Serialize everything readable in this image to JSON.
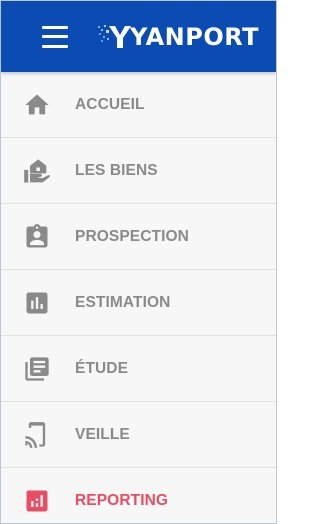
{
  "header": {
    "menu_icon": "hamburger-icon",
    "logo_text": "YANPORT",
    "background_color": "#0b4cb4"
  },
  "menu": {
    "default_color": "#8a8a8a",
    "active_color": "#e84d63",
    "items": [
      {
        "label": "ACCUEIL",
        "icon": "home-icon",
        "active": false
      },
      {
        "label": "LES BIENS",
        "icon": "house-hand-icon",
        "active": false
      },
      {
        "label": "PROSPECTION",
        "icon": "clipboard-person-icon",
        "active": false
      },
      {
        "label": "ESTIMATION",
        "icon": "bar-chart-icon",
        "active": false
      },
      {
        "label": "ÉTUDE",
        "icon": "library-books-icon",
        "active": false
      },
      {
        "label": "VEILLE",
        "icon": "cast-icon",
        "active": false
      },
      {
        "label": "REPORTING",
        "icon": "reporting-chart-icon",
        "active": true
      }
    ]
  }
}
